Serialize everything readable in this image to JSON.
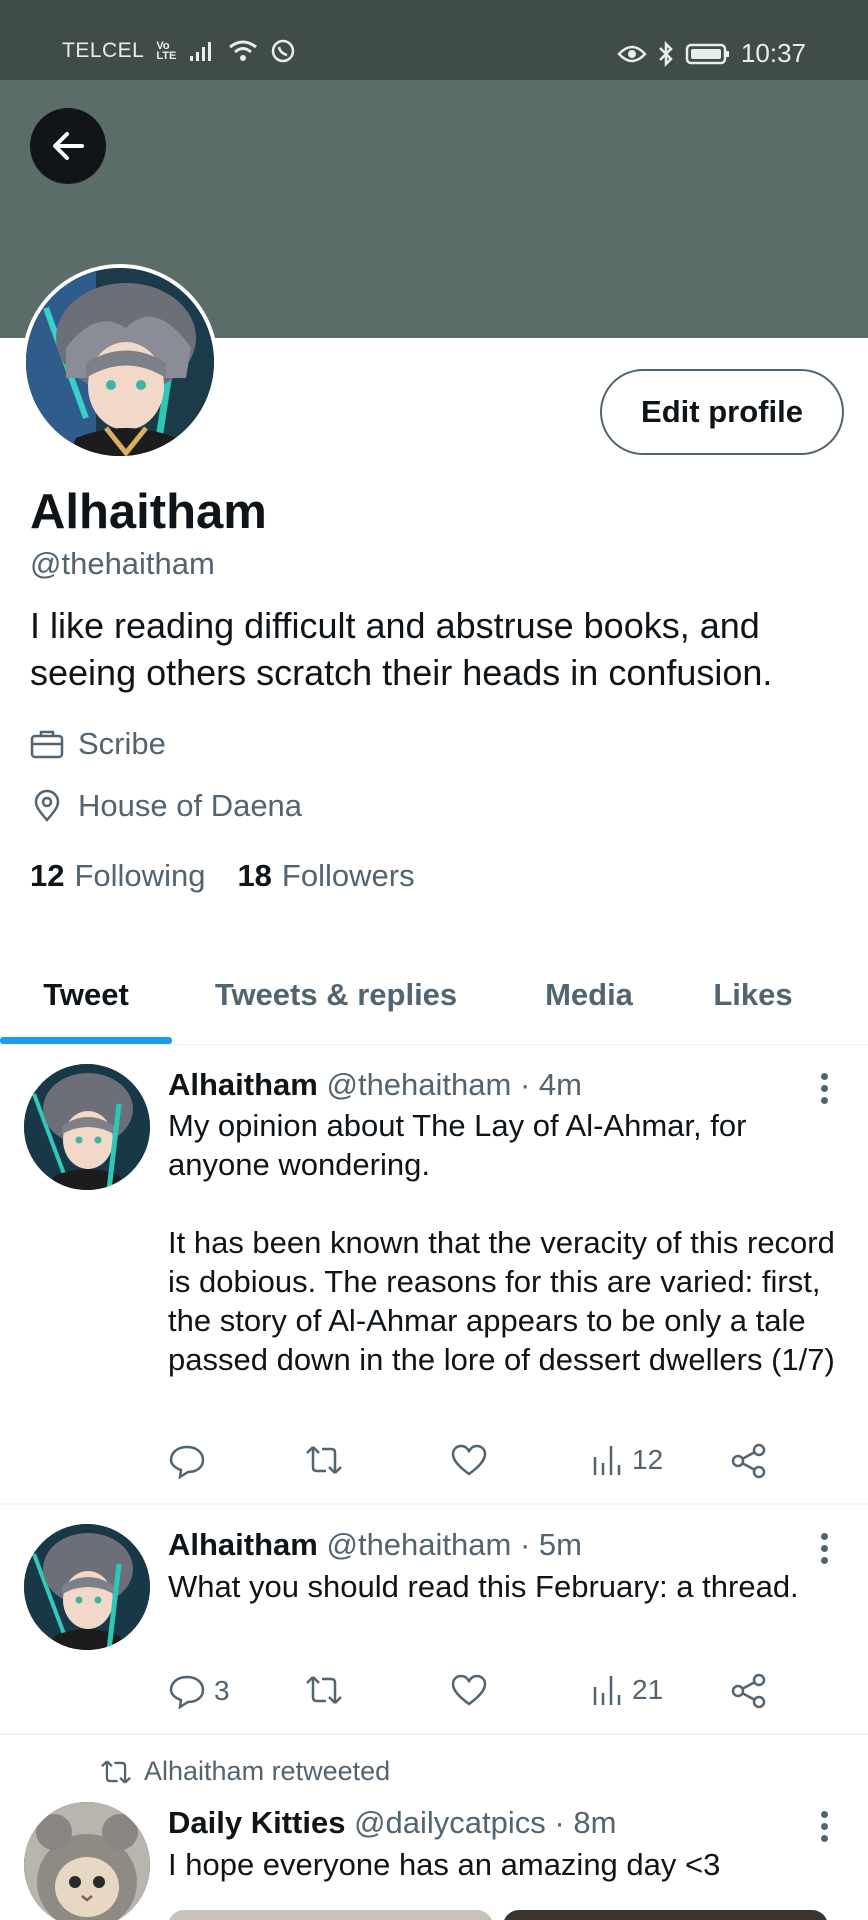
{
  "status_bar": {
    "carrier": "TELCEL",
    "network_top": "Vo",
    "network_bottom": "LTE",
    "time": "10:37"
  },
  "profile": {
    "name": "Alhaitham",
    "handle": "@thehaitham",
    "bio": "I like reading difficult and abstruse books, and seeing others scratch their heads in confusion.",
    "job": "Scribe",
    "location": "House of Daena",
    "following_count": "12",
    "following_label": "Following",
    "followers_count": "18",
    "followers_label": "Followers",
    "edit_label": "Edit profile"
  },
  "tabs": [
    {
      "label": "Tweet"
    },
    {
      "label": "Tweets & replies"
    },
    {
      "label": "Media"
    },
    {
      "label": "Likes"
    }
  ],
  "tweets": [
    {
      "name": "Alhaitham",
      "handle": "@thehaitham",
      "time": "· 4m",
      "text": "My opinion about The Lay of Al-Ahmar, for anyone wondering.\n\nIt has been known that the veracity of this record is dobious. The reasons for this are varied: first, the story of Al-Ahmar appears to be only a tale passed down in the lore of dessert dwellers (1/7)",
      "replies": "",
      "views": "12"
    },
    {
      "name": "Alhaitham",
      "handle": "@thehaitham",
      "time": "· 5m",
      "text": "What you should read this February: a thread.",
      "replies": "3",
      "views": "21"
    },
    {
      "retweet_label": "Alhaitham retweeted",
      "name": "Daily Kitties",
      "handle": "@dailycatpics",
      "time": "· 8m",
      "text": "I hope everyone has an amazing day <3"
    }
  ],
  "colors": {
    "accent": "#1d9bf0",
    "banner": "#5a6d69",
    "status_bar": "#3f4c4a"
  }
}
